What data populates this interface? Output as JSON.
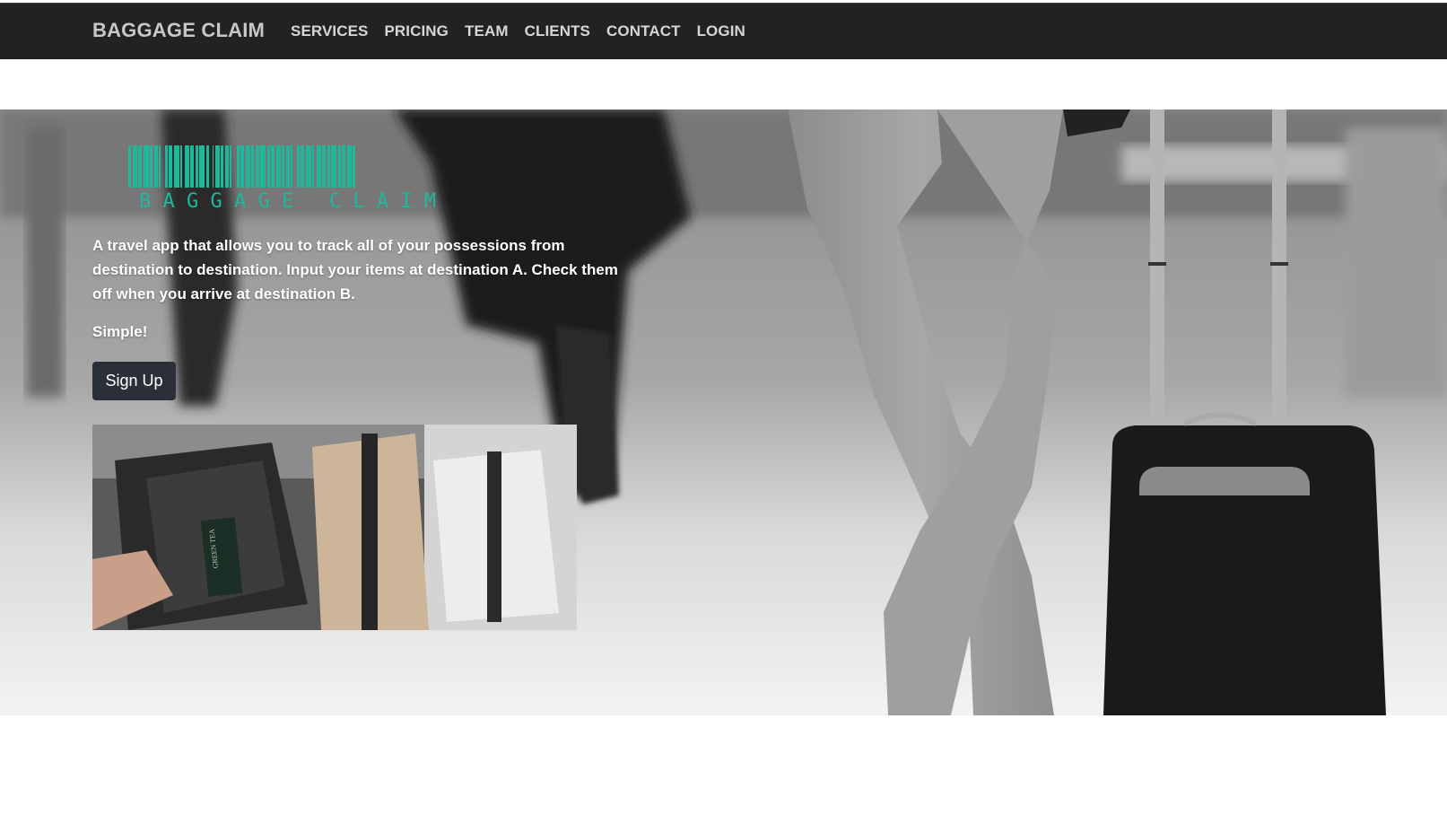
{
  "nav": {
    "brand": "BAGGAGE CLAIM",
    "links": [
      "SERVICES",
      "PRICING",
      "TEAM",
      "CLIENTS",
      "CONTACT",
      "LOGIN"
    ]
  },
  "hero": {
    "logo_word": "B A G G A G E   C L A I M",
    "description": "A travel app that allows you to track all of your possessions from destination to destination. Input your items at destination A. Check them off when you arrive at destination B.",
    "tagline": "Simple!",
    "signup_label": "Sign Up",
    "tea_label": "GREEN TEA"
  },
  "colors": {
    "navbar": "#222222",
    "accent": "#1fb89a",
    "button": "#2b3038"
  }
}
